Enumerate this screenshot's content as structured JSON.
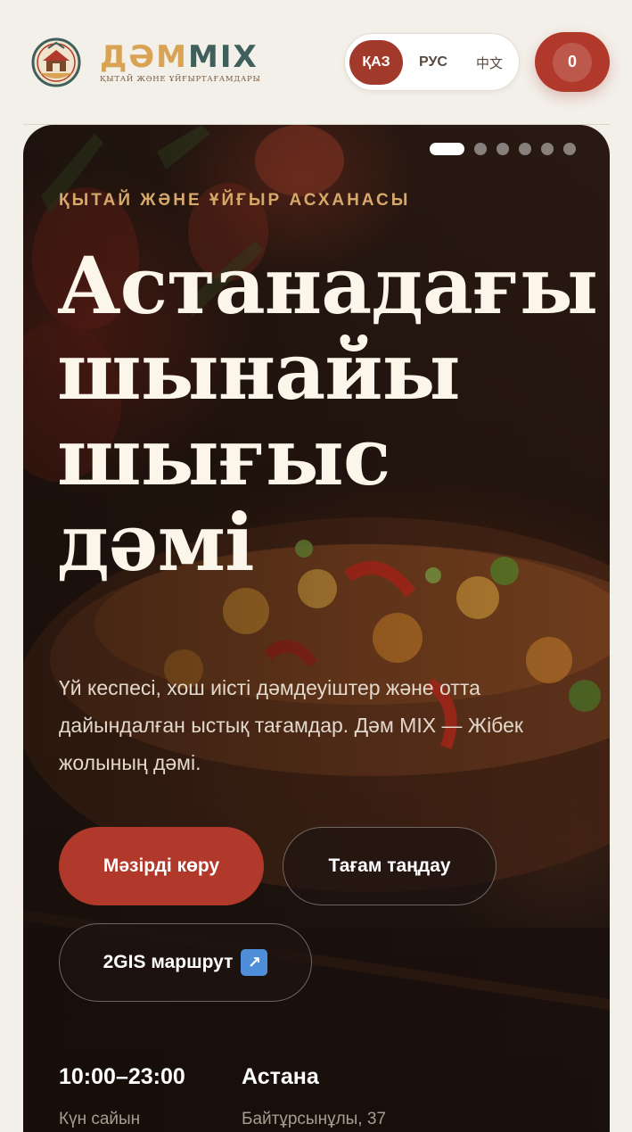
{
  "brand": {
    "wordmark_part1": "ДӘМ",
    "wordmark_part2": "MIX",
    "tagline": "ҚЫТАЙ ЖӘНЕ ҰЙҒЫРТАҒАМДАРЫ",
    "colors": {
      "gold": "#d8a355",
      "teal": "#3f5f5c"
    }
  },
  "language_switcher": {
    "options": [
      {
        "label": "ҚАЗ",
        "active": true
      },
      {
        "label": "РУС",
        "active": false
      },
      {
        "label": "中文",
        "active": false
      }
    ]
  },
  "cart": {
    "count": "0",
    "icon": "cart-icon"
  },
  "hero": {
    "slides_total": 6,
    "active_slide": 1,
    "eyebrow": "ҚЫТАЙ ЖӘНЕ ҰЙҒЫР АСХАНАСЫ",
    "title_lines": [
      "Астанадағы",
      "шынайы",
      "шығыс",
      "дәмі"
    ],
    "lead": "Үй кеспесі, хош иісті дәмдеуіштер және отта дайындалған ыстық тағамдар. Дәм MIX — Жібек жолының дәмі.",
    "buttons": {
      "menu": "Мәзірді көру",
      "choose": "Тағам таңдау",
      "route": "2GIS маршрут",
      "route_icon": "↗"
    },
    "info": {
      "hours": "10:00–23:00",
      "hours_sub": "Күн сайын",
      "city": "Астана",
      "address": "Байтұрсынұлы, 37"
    }
  },
  "colors": {
    "accent": "#b1392b",
    "eyebrow": "#d6a86a",
    "background": "#f3efe9"
  }
}
